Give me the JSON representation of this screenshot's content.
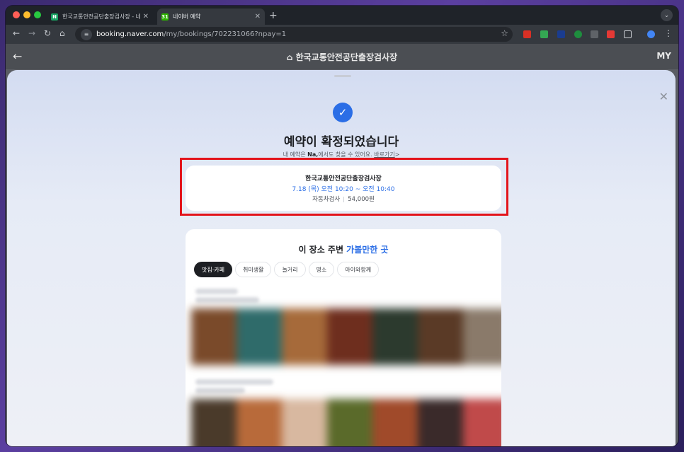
{
  "browser": {
    "tabs": [
      {
        "title": "한국교통안전공단출장검사장 - 네이",
        "favicon_color": "#19a463",
        "favicon_glyph": "N"
      },
      {
        "title": "네이버 예약",
        "favicon_color": "#2db400",
        "favicon_glyph": "31"
      }
    ],
    "new_tab": "+",
    "url_host": "booking.naver.com",
    "url_path": "/my/bookings/702231066?npay=1",
    "menu_glyph": "⋮"
  },
  "nav": {
    "back": "←",
    "title": "⌂ 한국교통안전공단출장검사장",
    "my": "MY"
  },
  "confirmation": {
    "close": "✕",
    "check": "✓",
    "headline": "예약이 확정되었습니다",
    "sub_prefix": "내 예약은 ",
    "sub_bold": "Na,",
    "sub_mid": "에서도 찾을 수 있어요. ",
    "sub_link": "바로가기",
    "sub_arrow": ">"
  },
  "booking": {
    "place": "한국교통안전공단출장검사장",
    "time": "7.18 (목) 오전 10:20 ~ 오전 10:40",
    "service": "자동차검사",
    "price": "54,000원"
  },
  "nearby": {
    "title_prefix": "이 장소 주변 ",
    "title_highlight": "가볼만한 곳",
    "chips": [
      "맛집·카페",
      "취미생활",
      "놀거리",
      "명소",
      "아이와함께"
    ],
    "active_chip": 0
  },
  "colors": {
    "accent": "#2b6ee6",
    "highlight_box": "#e3141b"
  }
}
